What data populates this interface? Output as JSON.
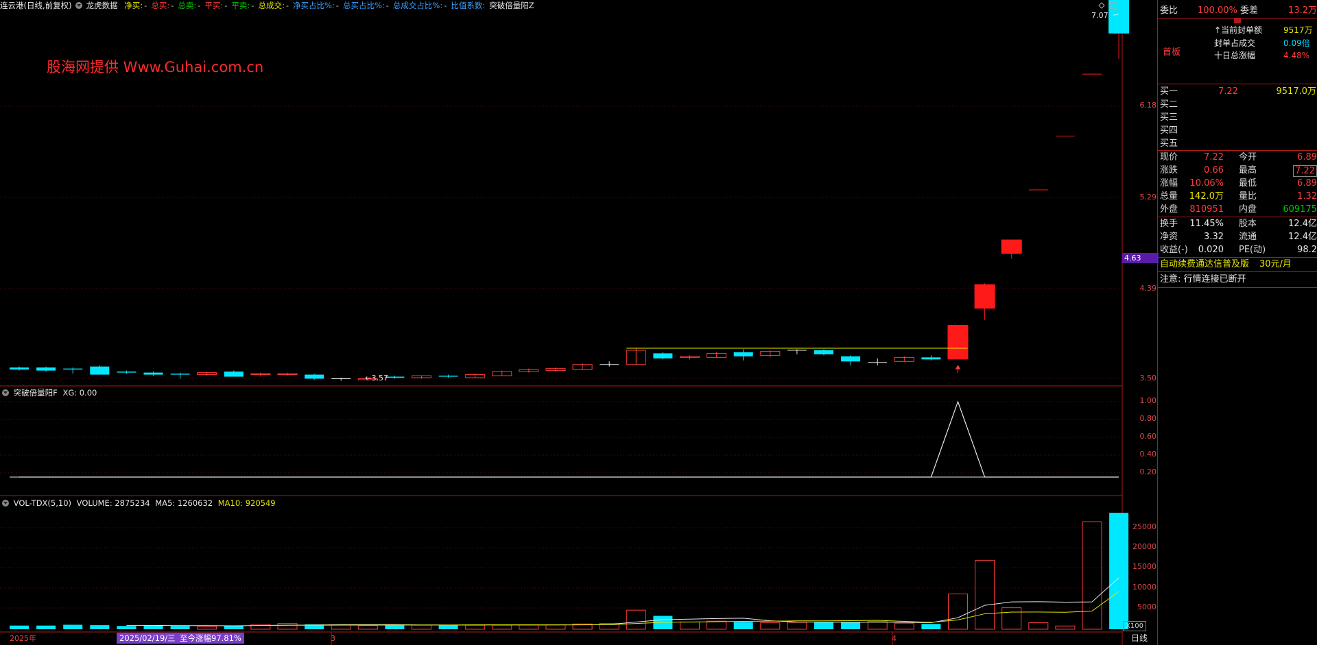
{
  "toolbar": {
    "title": "连云港(日线,前复权)",
    "source": "龙虎数据",
    "items": [
      {
        "label": "净买:",
        "val": "-",
        "color": "#e6e600"
      },
      {
        "label": "总买:",
        "val": "-",
        "color": "#ff3c3c"
      },
      {
        "label": "总卖:",
        "val": "-",
        "color": "#00c800"
      },
      {
        "label": "平买:",
        "val": "-",
        "color": "#ff3c3c"
      },
      {
        "label": "平卖:",
        "val": "-",
        "color": "#00c800"
      },
      {
        "label": "总成交:",
        "val": "-",
        "color": "#e6e600"
      },
      {
        "label": "净买占比%:",
        "val": "-",
        "color": "#3aa0ff"
      },
      {
        "label": "总买占比%:",
        "val": "-",
        "color": "#3aa0ff"
      },
      {
        "label": "总成交占比%:",
        "val": "-",
        "color": "#3aa0ff"
      },
      {
        "label": "比值系数:",
        "val": "",
        "color": "#3aa0ff"
      },
      {
        "label": "突破倍量阳Z",
        "val": "",
        "color": "#e8e8e8"
      }
    ]
  },
  "watermark": "股海网提供  Www.Guhai.com.cn",
  "main_chart": {
    "y_ticks": [
      "6.18",
      "5.29",
      "4.39",
      "3.50"
    ],
    "current_price_tag": "4.63",
    "high_label": "7.07",
    "low_label": "←3.57"
  },
  "indicator": {
    "name": "突破倍量阳F",
    "value_label": "XG: 0.00",
    "y_ticks": [
      "1.00",
      "0.80",
      "0.60",
      "0.40",
      "0.20"
    ]
  },
  "volume": {
    "name": "VOL-TDX(5,10)",
    "volume_label": "VOLUME: 2875234",
    "ma5_label": "MA5: 1260632",
    "ma10_label": "MA10: 920549",
    "y_ticks": [
      "25000",
      "20000",
      "15000",
      "10000",
      "5000"
    ],
    "unit": "X100"
  },
  "xaxis": {
    "year": "2025年",
    "date_tag": "2025/02/19/三",
    "gain_tag": "至今涨幅97.81%",
    "m3": "3",
    "m4": "4",
    "period": "日线"
  },
  "chart_data": {
    "type": "candlestick",
    "ohlc_approx": [
      {
        "o": 3.6,
        "h": 3.61,
        "l": 3.57,
        "c": 3.58
      },
      {
        "o": 3.6,
        "h": 3.61,
        "l": 3.56,
        "c": 3.57
      },
      {
        "o": 3.59,
        "h": 3.6,
        "l": 3.54,
        "c": 3.58
      },
      {
        "o": 3.61,
        "h": 3.62,
        "l": 3.53,
        "c": 3.53
      },
      {
        "o": 3.56,
        "h": 3.57,
        "l": 3.54,
        "c": 3.55
      },
      {
        "o": 3.55,
        "h": 3.56,
        "l": 3.52,
        "c": 3.53
      },
      {
        "o": 3.54,
        "h": 3.55,
        "l": 3.49,
        "c": 3.53
      },
      {
        "o": 3.53,
        "h": 3.56,
        "l": 3.52,
        "c": 3.55
      },
      {
        "o": 3.56,
        "h": 3.57,
        "l": 3.51,
        "c": 3.51
      },
      {
        "o": 3.53,
        "h": 3.55,
        "l": 3.51,
        "c": 3.54
      },
      {
        "o": 3.53,
        "h": 3.55,
        "l": 3.52,
        "c": 3.54
      },
      {
        "o": 3.53,
        "h": 3.54,
        "l": 3.48,
        "c": 3.49
      },
      {
        "o": 3.49,
        "h": 3.5,
        "l": 3.47,
        "c": 3.49
      },
      {
        "o": 3.48,
        "h": 3.5,
        "l": 3.47,
        "c": 3.49
      },
      {
        "o": 3.51,
        "h": 3.52,
        "l": 3.49,
        "c": 3.5
      },
      {
        "o": 3.5,
        "h": 3.52,
        "l": 3.49,
        "c": 3.52
      },
      {
        "o": 3.52,
        "h": 3.53,
        "l": 3.5,
        "c": 3.51
      },
      {
        "o": 3.5,
        "h": 3.54,
        "l": 3.5,
        "c": 3.53
      },
      {
        "o": 3.52,
        "h": 3.57,
        "l": 3.52,
        "c": 3.56
      },
      {
        "o": 3.56,
        "h": 3.59,
        "l": 3.55,
        "c": 3.58
      },
      {
        "o": 3.57,
        "h": 3.6,
        "l": 3.56,
        "c": 3.59
      },
      {
        "o": 3.58,
        "h": 3.64,
        "l": 3.58,
        "c": 3.63
      },
      {
        "o": 3.63,
        "h": 3.66,
        "l": 3.61,
        "c": 3.63
      },
      {
        "o": 3.63,
        "h": 3.79,
        "l": 3.63,
        "c": 3.77
      },
      {
        "o": 3.74,
        "h": 3.75,
        "l": 3.68,
        "c": 3.69
      },
      {
        "o": 3.7,
        "h": 3.72,
        "l": 3.68,
        "c": 3.71
      },
      {
        "o": 3.7,
        "h": 3.75,
        "l": 3.7,
        "c": 3.74
      },
      {
        "o": 3.75,
        "h": 3.78,
        "l": 3.67,
        "c": 3.71
      },
      {
        "o": 3.72,
        "h": 3.77,
        "l": 3.7,
        "c": 3.76
      },
      {
        "o": 3.77,
        "h": 3.78,
        "l": 3.73,
        "c": 3.77
      },
      {
        "o": 3.77,
        "h": 3.78,
        "l": 3.72,
        "c": 3.73
      },
      {
        "o": 3.71,
        "h": 3.72,
        "l": 3.62,
        "c": 3.66
      },
      {
        "o": 3.65,
        "h": 3.69,
        "l": 3.62,
        "c": 3.65
      },
      {
        "o": 3.66,
        "h": 3.71,
        "l": 3.66,
        "c": 3.7
      },
      {
        "o": 3.7,
        "h": 3.72,
        "l": 3.67,
        "c": 3.68
      },
      {
        "o": 3.68,
        "h": 4.02,
        "l": 3.68,
        "c": 4.02
      },
      {
        "o": 4.18,
        "h": 4.43,
        "l": 4.07,
        "c": 4.42
      },
      {
        "o": 4.72,
        "h": 4.86,
        "l": 4.67,
        "c": 4.86
      },
      {
        "o": 5.35,
        "h": 5.35,
        "l": 5.35,
        "c": 5.35
      },
      {
        "o": 5.88,
        "h": 5.88,
        "l": 5.88,
        "c": 5.88
      },
      {
        "o": 6.49,
        "h": 6.49,
        "l": 6.49,
        "c": 6.49
      },
      {
        "o": 6.89,
        "h": 7.07,
        "l": 6.64,
        "c": 7.22
      }
    ],
    "signal": [
      0,
      0,
      0,
      0,
      0,
      0,
      0,
      0,
      0,
      0,
      0,
      0,
      0,
      0,
      0,
      0,
      0,
      0,
      0,
      0,
      0,
      0,
      0,
      0,
      0,
      0,
      0,
      0,
      0,
      0,
      0,
      0,
      0,
      0,
      0,
      1,
      0,
      0,
      0,
      0,
      0,
      0
    ],
    "volume_x100": [
      900,
      900,
      1100,
      1000,
      800,
      900,
      800,
      700,
      900,
      1200,
      1400,
      1200,
      1000,
      900,
      1200,
      1000,
      1100,
      1000,
      1000,
      1100,
      1100,
      1300,
      1400,
      4700,
      3300,
      1800,
      2000,
      1800,
      1600,
      1700,
      1700,
      1800,
      1900,
      1500,
      1300,
      8700,
      17000,
      5300,
      1600,
      800,
      26500,
      28700
    ],
    "ma5": [
      null,
      null,
      null,
      null,
      940,
      940,
      880,
      880,
      840,
      900,
      1000,
      1040,
      1140,
      1140,
      1140,
      1060,
      1040,
      1040,
      1060,
      1040,
      1060,
      1100,
      1180,
      1780,
      2360,
      2500,
      2640,
      2720,
      2100,
      1780,
      1760,
      1720,
      1740,
      1720,
      1600,
      2840,
      5900,
      6740,
      6780,
      6680,
      6740,
      12680
    ],
    "ma10": [
      null,
      null,
      null,
      null,
      null,
      null,
      null,
      null,
      null,
      920,
      970,
      970,
      1010,
      1020,
      1020,
      1030,
      1040,
      1090,
      1100,
      1100,
      1080,
      1070,
      1110,
      1420,
      1710,
      1780,
      1860,
      1950,
      2000,
      2060,
      2070,
      2110,
      2190,
      1940,
      1680,
      2300,
      3810,
      4220,
      4240,
      4180,
      4480,
      9290
    ]
  },
  "right_panel": {
    "weibi_label": "委比",
    "weibi_val": "100.00%",
    "weicha_label": "委差",
    "weicha_val": "13.2万",
    "shouban": "首板",
    "feng_lines": [
      {
        "label": "↑当前封单额",
        "val": "9517万"
      },
      {
        "label": "封单占成交",
        "val": "0.09倍"
      },
      {
        "label": "十日总涨幅",
        "val": "4.48%"
      }
    ],
    "bids": [
      {
        "label": "买一",
        "price": "7.22",
        "vol": "9517.0万"
      },
      {
        "label": "买二",
        "price": "",
        "vol": ""
      },
      {
        "label": "买三",
        "price": "",
        "vol": ""
      },
      {
        "label": "买四",
        "price": "",
        "vol": ""
      },
      {
        "label": "买五",
        "price": "",
        "vol": ""
      }
    ],
    "stats": [
      {
        "l1": "现价",
        "v1": "7.22",
        "c1": "red",
        "l2": "今开",
        "v2": "6.89",
        "c2": "red"
      },
      {
        "l1": "涨跌",
        "v1": "0.66",
        "c1": "red",
        "l2": "最高",
        "v2": "7.22",
        "c2": "red"
      },
      {
        "l1": "涨幅",
        "v1": "10.06%",
        "c1": "red",
        "l2": "最低",
        "v2": "6.89",
        "c2": "red"
      },
      {
        "l1": "总量",
        "v1": "142.0万",
        "c1": "yel",
        "l2": "量比",
        "v2": "1.32",
        "c2": "red"
      },
      {
        "l1": "外盘",
        "v1": "810951",
        "c1": "red",
        "l2": "内盘",
        "v2": "609175",
        "c2": "grn"
      }
    ],
    "stats2": [
      {
        "l1": "换手",
        "v1": "11.45%",
        "l2": "股本",
        "v2": "12.4亿"
      },
      {
        "l1": "净资",
        "v1": "3.32",
        "l2": "流通",
        "v2": "12.4亿"
      },
      {
        "l1": "收益(-)",
        "v1": "0.020",
        "l2": "PE(动)",
        "v2": "98.2"
      }
    ],
    "promo": "自动续费通达信普及版",
    "promo_price": "30元/月",
    "notice": "注意: 行情连接已断开"
  }
}
